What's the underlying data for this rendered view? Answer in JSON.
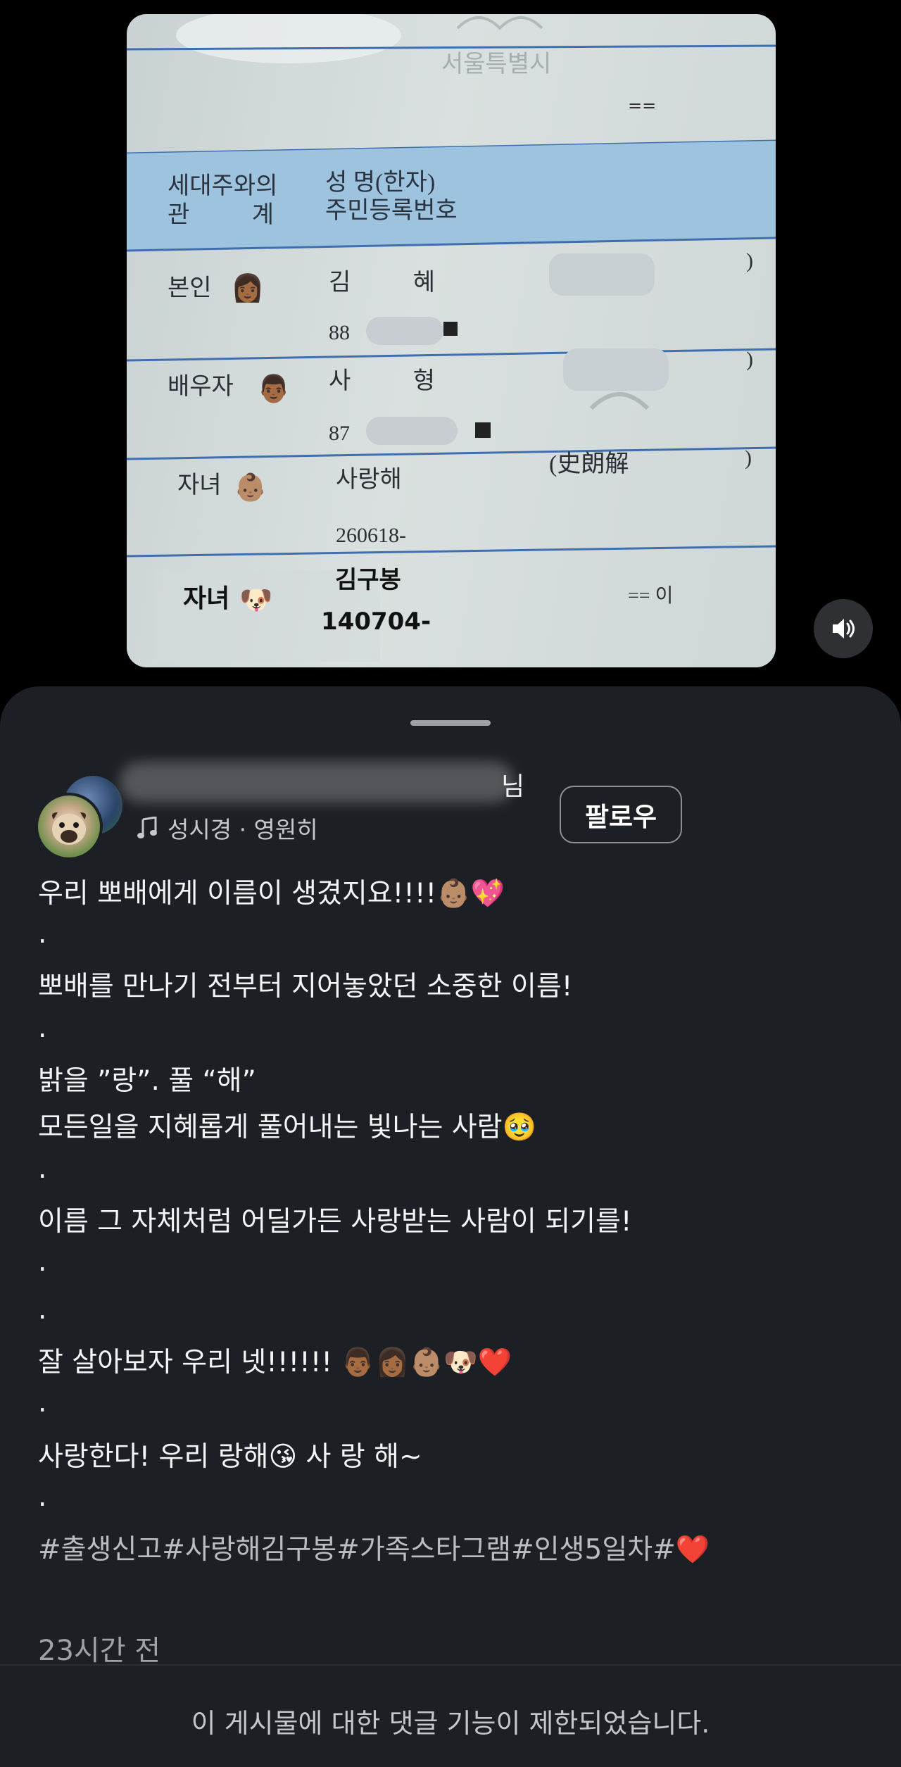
{
  "photo": {
    "doc_title": "서울특별시",
    "doc_mark": "==",
    "header_col1_line1": "세대주와의",
    "header_col1_line2": "관 계",
    "header_col2_line1": "성 명(한자)",
    "header_col2_line2": "주민등록번호",
    "rows": [
      {
        "relation": "본인",
        "name": "김 혜",
        "id": "88",
        "emoji": "👩🏾"
      },
      {
        "relation": "배우자",
        "name": "사 형",
        "id": "87",
        "emoji": "👨🏾"
      },
      {
        "relation": "자녀",
        "name": "사랑해",
        "id": "260618-",
        "emoji": "👶🏽",
        "hanja": "(史朗解"
      },
      {
        "relation": "자녀",
        "name": "김구봉",
        "id": "140704-",
        "emoji": "🐶",
        "mark": "== 이"
      }
    ]
  },
  "post": {
    "username_suffix": "님",
    "music": "성시경 · 영원히",
    "follow_label": "팔로우",
    "caption_lines": [
      "우리 뽀배에게 이름이 생겼지요!!!!👶🏽💖",
      ".",
      "뽀배를 만나기 전부터 지어놓았던 소중한 이름!",
      ".",
      "밝을 ”랑”. 풀 “해”",
      "모든일을 지혜롭게 풀어내는 빛나는 사람🥹",
      ".",
      "이름 그 자체처럼 어딜가든 사랑받는 사람이 되기를!",
      ".",
      ".",
      "잘 살아보자 우리 넷!!!!!! 👨🏾👩🏾👶🏽🐶❤️",
      ".",
      "사랑한다! 우리 랑해😘 사 랑 해~",
      ".",
      "#출생신고#사랑해김구봉#가족스타그램#인생5일차#❤️"
    ],
    "timestamp": "23시간 전",
    "comments_disabled": "이 게시물에 대한 댓글 기능이 제한되었습니다."
  },
  "colors": {
    "sheet_bg": "#1c1f23",
    "doc_header_band": "#9ec3de"
  },
  "icons": [
    "speaker-icon",
    "music-note-icon"
  ]
}
